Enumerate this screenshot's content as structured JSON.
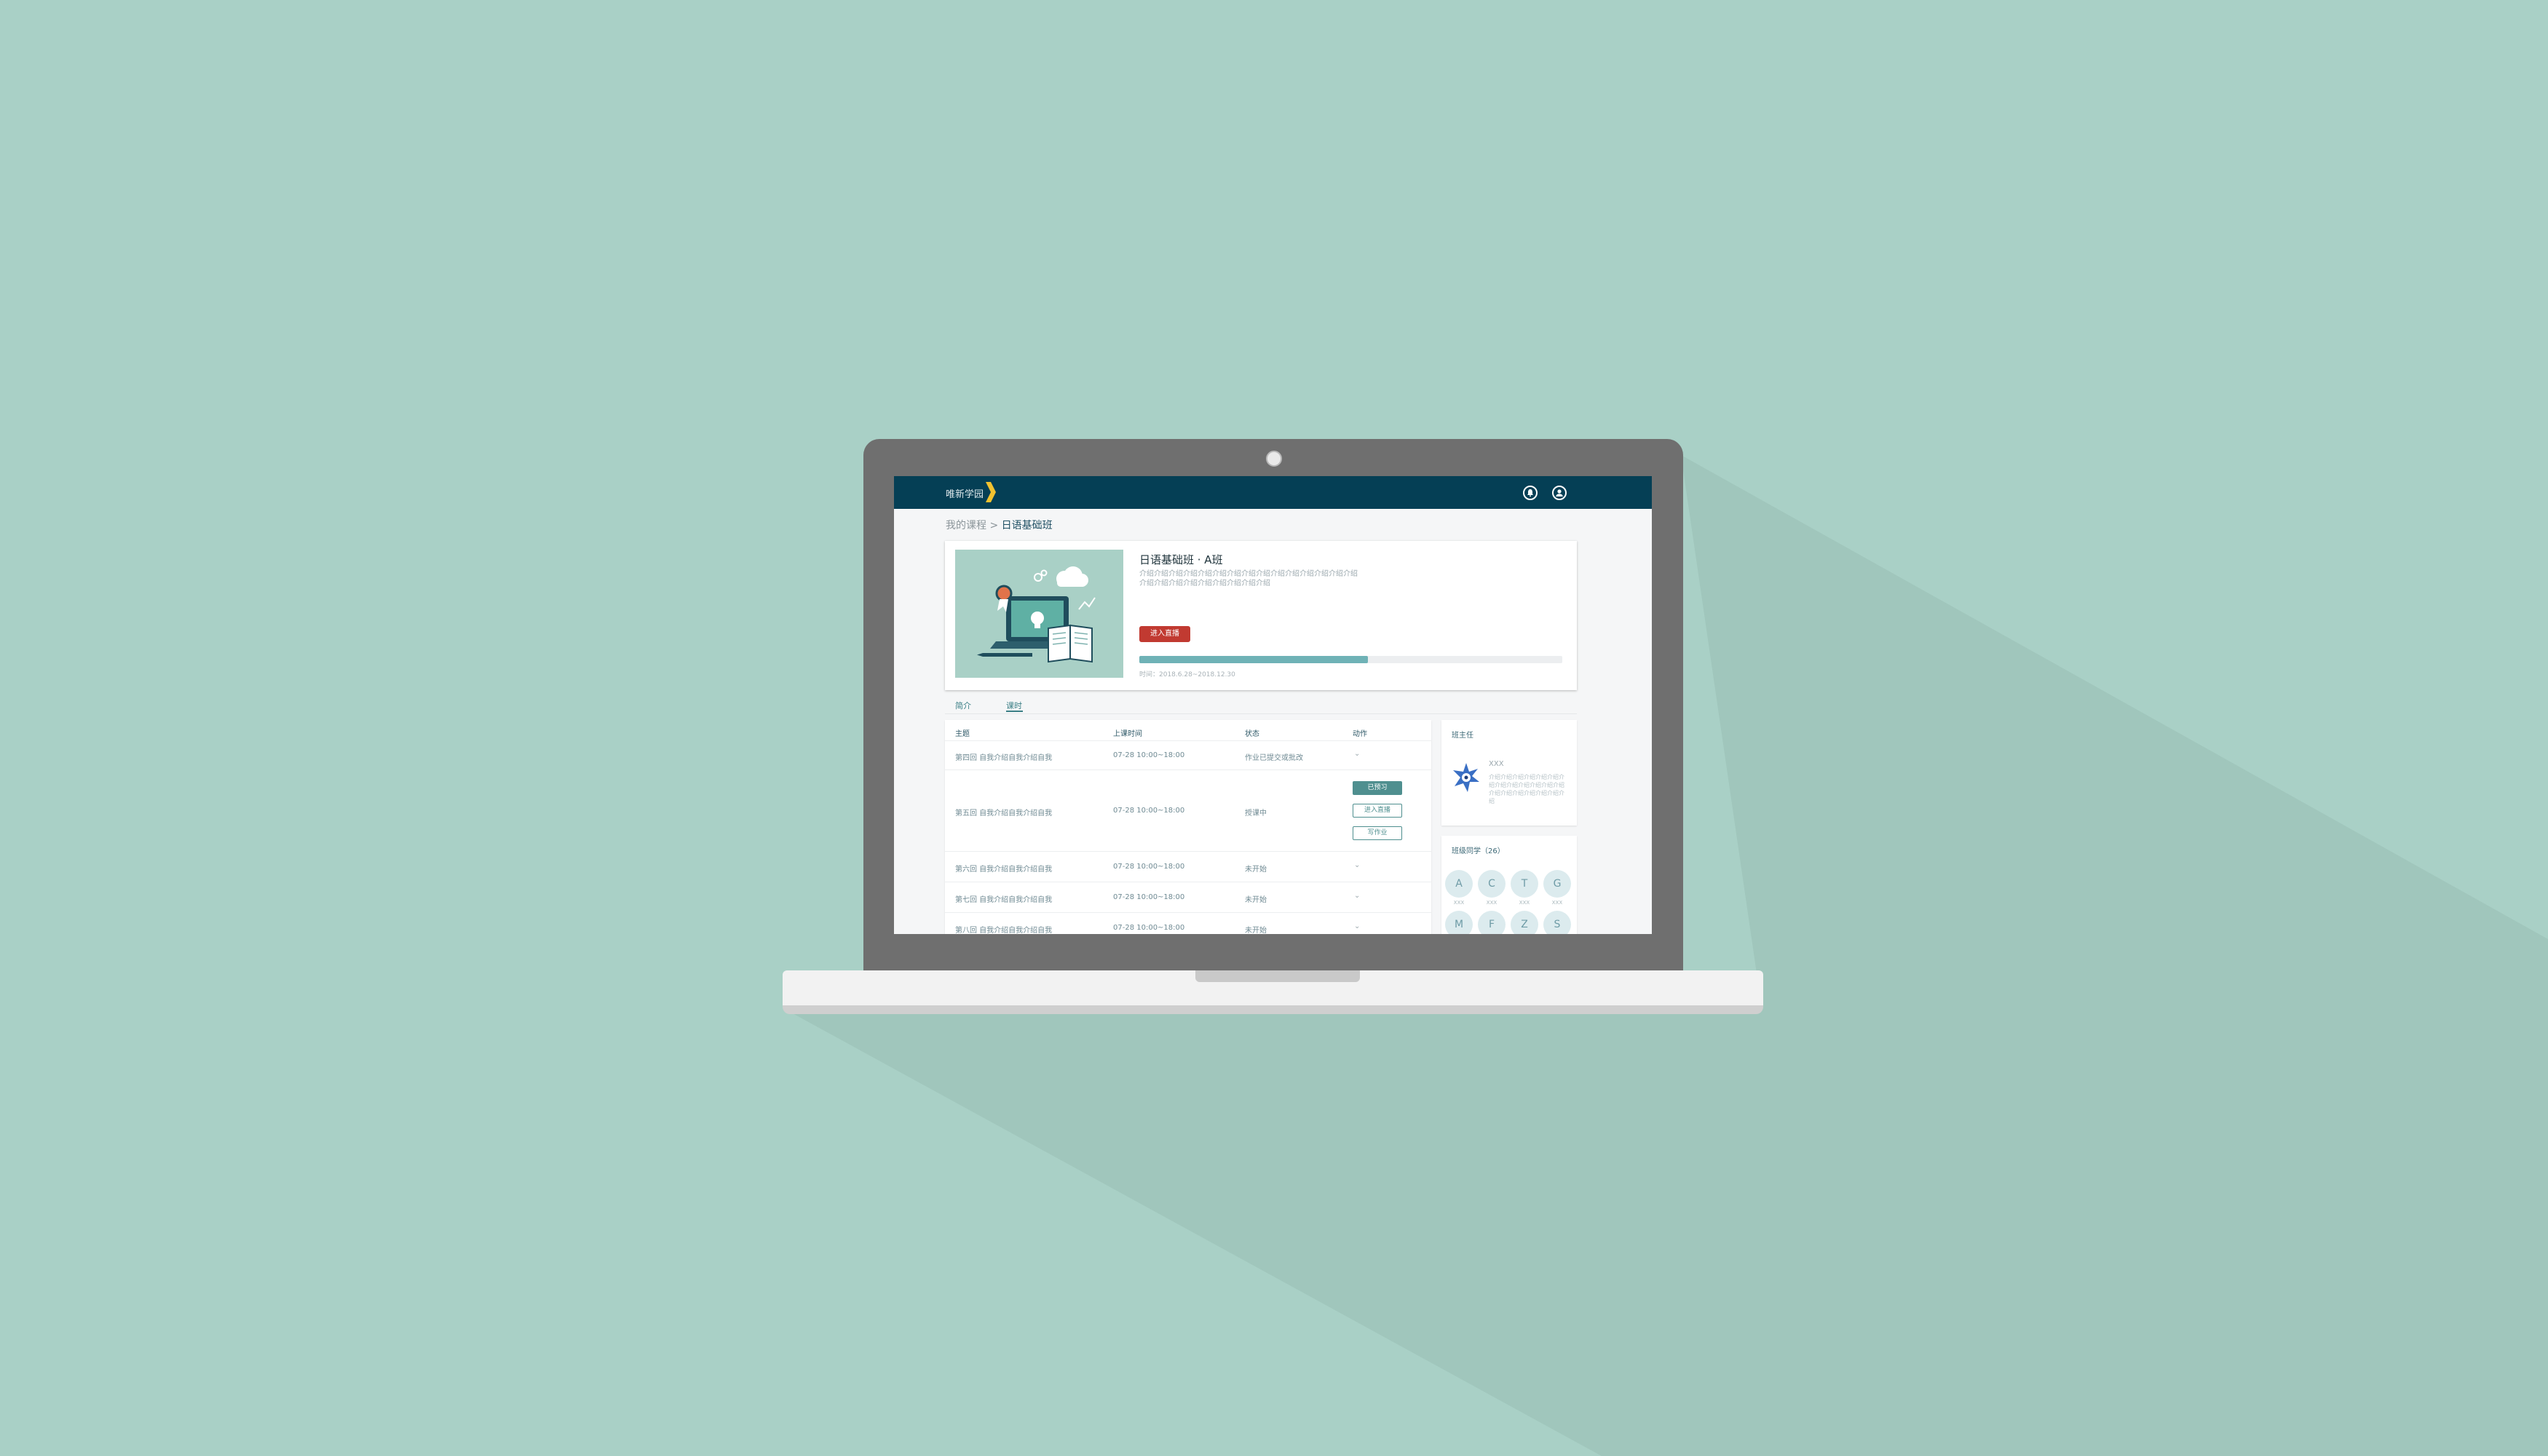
{
  "header": {
    "logo_text": "唯新学园",
    "notification_icon": "bell-icon",
    "user_icon": "user-icon"
  },
  "breadcrumb": {
    "parent": "我的课程 >",
    "current": "日语基础班"
  },
  "course": {
    "title": "日语基础班 · A班",
    "description": "介绍介绍介绍介绍介绍介绍介绍介绍介绍介绍介绍介绍介绍介绍介绍介绍介绍介绍介绍介绍介绍介绍介绍介绍",
    "live_button": "进入直播",
    "progress": 0.54,
    "date_range": "时间：2018.6.28~2018.12.30"
  },
  "tabs": [
    {
      "label": "简介"
    },
    {
      "label": "课时",
      "active": true
    }
  ],
  "lessons": {
    "headers": [
      "主题",
      "上课时间",
      "状态",
      "动作"
    ],
    "rows": [
      {
        "topic": "第四回 自我介绍自我介绍自我",
        "time": "07-28 10:00~18:00",
        "status": "作业已提交或批改"
      },
      {
        "topic": "第五回 自我介绍自我介绍自我",
        "time": "07-28 10:00~18:00",
        "status": "授课中",
        "actions": [
          "已预习",
          "进入直播",
          "写作业"
        ]
      },
      {
        "topic": "第六回 自我介绍自我介绍自我",
        "time": "07-28 10:00~18:00",
        "status": "未开始"
      },
      {
        "topic": "第七回 自我介绍自我介绍自我",
        "time": "07-28 10:00~18:00",
        "status": "未开始"
      },
      {
        "topic": "第八回 自我介绍自我介绍自我",
        "time": "07-28 10:00~18:00",
        "status": "未开始"
      }
    ]
  },
  "teacher": {
    "title": "班主任",
    "name": "XXX",
    "bio": "介绍介绍介绍介绍介绍介绍介绍介绍介绍介绍介绍介绍介绍介绍介绍介绍介绍介绍介绍介绍"
  },
  "classmates": {
    "title": "班级同学（26）",
    "members": [
      {
        "initial": "A",
        "name": "XXX"
      },
      {
        "initial": "C",
        "name": "XXX"
      },
      {
        "initial": "T",
        "name": "XXX"
      },
      {
        "initial": "G",
        "name": "XXX"
      },
      {
        "initial": "M",
        "name": ""
      },
      {
        "initial": "F",
        "name": ""
      },
      {
        "initial": "Z",
        "name": ""
      },
      {
        "initial": "S",
        "name": ""
      }
    ]
  },
  "colors": {
    "background": "#a9d0c6",
    "header": "#053f55",
    "accent_yellow": "#f2c230",
    "live_red": "#c13a31",
    "progress": "#6fb2b6",
    "action_teal": "#4f8f8f"
  }
}
